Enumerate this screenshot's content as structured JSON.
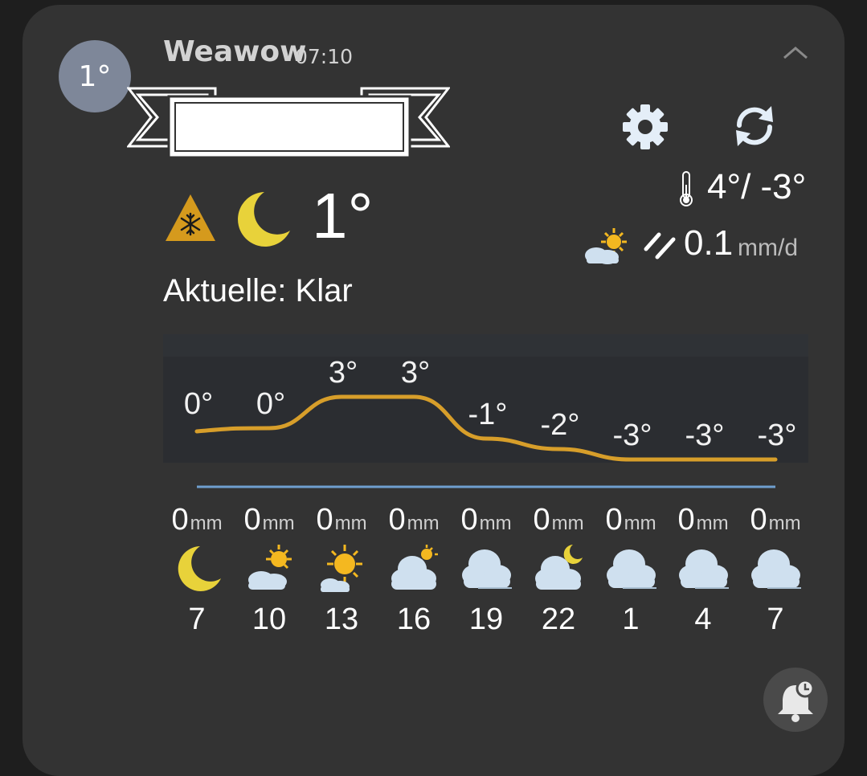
{
  "notification": {
    "avatar_text": "1°",
    "app_name": "Weawow",
    "time": "07:10"
  },
  "current": {
    "temp": "1°",
    "condition": "Aktuelle: Klar",
    "temp_range": "4°/ -3°",
    "precip_value": "0.1",
    "precip_unit": "mm/d"
  },
  "icons": {
    "collapse": "chevron-up-icon",
    "settings": "gear-icon",
    "refresh": "refresh-icon",
    "warning": "snow-warning-icon",
    "current_weather": "moon-icon",
    "thermometer": "thermometer-icon",
    "daily_weather": "partly-sunny-icon",
    "precipitation": "rain-icon",
    "alarm": "bell-clock-icon"
  },
  "colors": {
    "card_bg": "#333333",
    "temp_line": "#d79e2a",
    "precip_line": "#6f9fcf",
    "avatar_bg": "#7e8799"
  },
  "chart_data": {
    "type": "line",
    "x": [
      "7",
      "10",
      "13",
      "16",
      "19",
      "22",
      "1",
      "4",
      "7"
    ],
    "series": [
      {
        "values": [
          0,
          0,
          3,
          3,
          -1,
          -2,
          -3,
          -3,
          -3
        ]
      }
    ],
    "data_labels": [
      "0°",
      "0°",
      "3°",
      "3°",
      "-1°",
      "-2°",
      "-3°",
      "-3°",
      "-3°"
    ],
    "ylim": [
      -3,
      3
    ],
    "precip_line": [
      0,
      0,
      0,
      0,
      0,
      0,
      0,
      0,
      0
    ]
  },
  "hourly": [
    {
      "hour": "7",
      "precip": "0",
      "unit": "mm",
      "icon": "moon-icon"
    },
    {
      "hour": "10",
      "precip": "0",
      "unit": "mm",
      "icon": "partly-sunny-icon"
    },
    {
      "hour": "13",
      "precip": "0",
      "unit": "mm",
      "icon": "mostly-sunny-icon"
    },
    {
      "hour": "16",
      "precip": "0",
      "unit": "mm",
      "icon": "cloudy-sun-icon"
    },
    {
      "hour": "19",
      "precip": "0",
      "unit": "mm",
      "icon": "cloud-icon"
    },
    {
      "hour": "22",
      "precip": "0",
      "unit": "mm",
      "icon": "cloudy-moon-icon"
    },
    {
      "hour": "1",
      "precip": "0",
      "unit": "mm",
      "icon": "cloud-icon"
    },
    {
      "hour": "4",
      "precip": "0",
      "unit": "mm",
      "icon": "cloud-icon"
    },
    {
      "hour": "7",
      "precip": "0",
      "unit": "mm",
      "icon": "cloud-icon"
    }
  ]
}
